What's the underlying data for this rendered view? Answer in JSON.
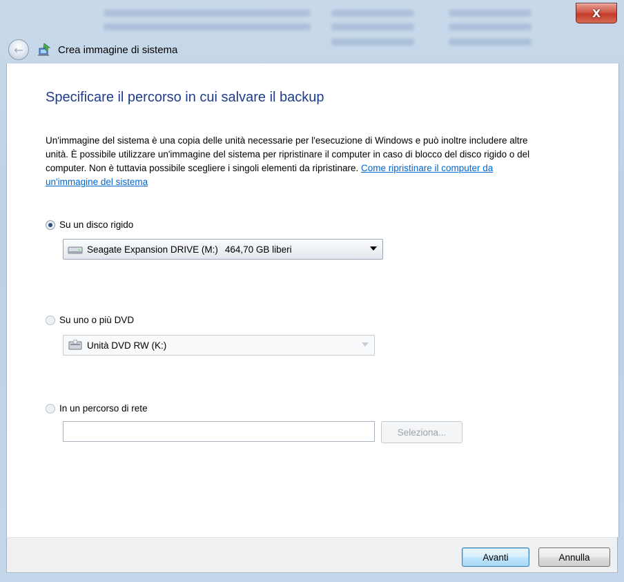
{
  "window": {
    "title": "Crea immagine di sistema",
    "close_glyph": "X"
  },
  "main": {
    "heading": "Specificare il percorso in cui salvare il backup",
    "description": "Un'immagine del sistema è una copia delle unità necessarie per l'esecuzione di Windows e può inoltre includere altre unità. È possibile utilizzare un'immagine del sistema per ripristinare il computer in caso di blocco del disco rigido o del computer. Non è tuttavia possibile scegliere i singoli elementi da ripristinare.",
    "help_link": "Come ripristinare il computer da un'immagine del sistema"
  },
  "options": {
    "hard_disk": {
      "label": "Su un disco rigido",
      "selected": true,
      "drive_name": "Seagate Expansion DRIVE (M:)",
      "free_space": "464,70 GB liberi",
      "icon": "hard-drive-icon"
    },
    "dvd": {
      "label": "Su uno o più DVD",
      "selected": false,
      "drive_name": "Unità DVD RW (K:)",
      "icon": "dvd-drive-icon"
    },
    "network": {
      "label": "In un percorso di rete",
      "selected": false,
      "path_value": "",
      "browse_label": "Seleziona..."
    }
  },
  "footer": {
    "next_label": "Avanti",
    "cancel_label": "Annulla"
  },
  "colors": {
    "heading": "#1e3c8a",
    "link": "#0066cc",
    "close_button": "#c43a28",
    "glass_frame": "#bcd0e6"
  }
}
